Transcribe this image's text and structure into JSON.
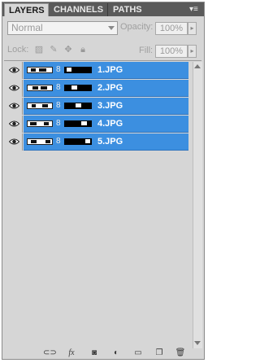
{
  "tabs": [
    {
      "label": "LAYERS",
      "active": true
    },
    {
      "label": "CHANNELS",
      "active": false
    },
    {
      "label": "PATHS",
      "active": false
    }
  ],
  "blend_mode": {
    "value": "Normal"
  },
  "opacity": {
    "label": "Opacity:",
    "value": "100%"
  },
  "lock": {
    "label": "Lock:"
  },
  "fill": {
    "label": "Fill:",
    "value": "100%"
  },
  "layers": [
    {
      "name": "1.JPG",
      "visible": true,
      "selected": true
    },
    {
      "name": "2.JPG",
      "visible": true,
      "selected": true
    },
    {
      "name": "3.JPG",
      "visible": true,
      "selected": true
    },
    {
      "name": "4.JPG",
      "visible": true,
      "selected": true
    },
    {
      "name": "5.JPG",
      "visible": true,
      "selected": true
    }
  ],
  "bottom_icons": [
    "link-icon",
    "fx-icon",
    "mask-icon",
    "adjustment-icon",
    "folder-icon",
    "new-layer-icon",
    "trash-icon"
  ],
  "colors": {
    "selection": "#3c8fe0",
    "panel": "#d6d6d6",
    "tabbar": "#5a5a5a"
  }
}
